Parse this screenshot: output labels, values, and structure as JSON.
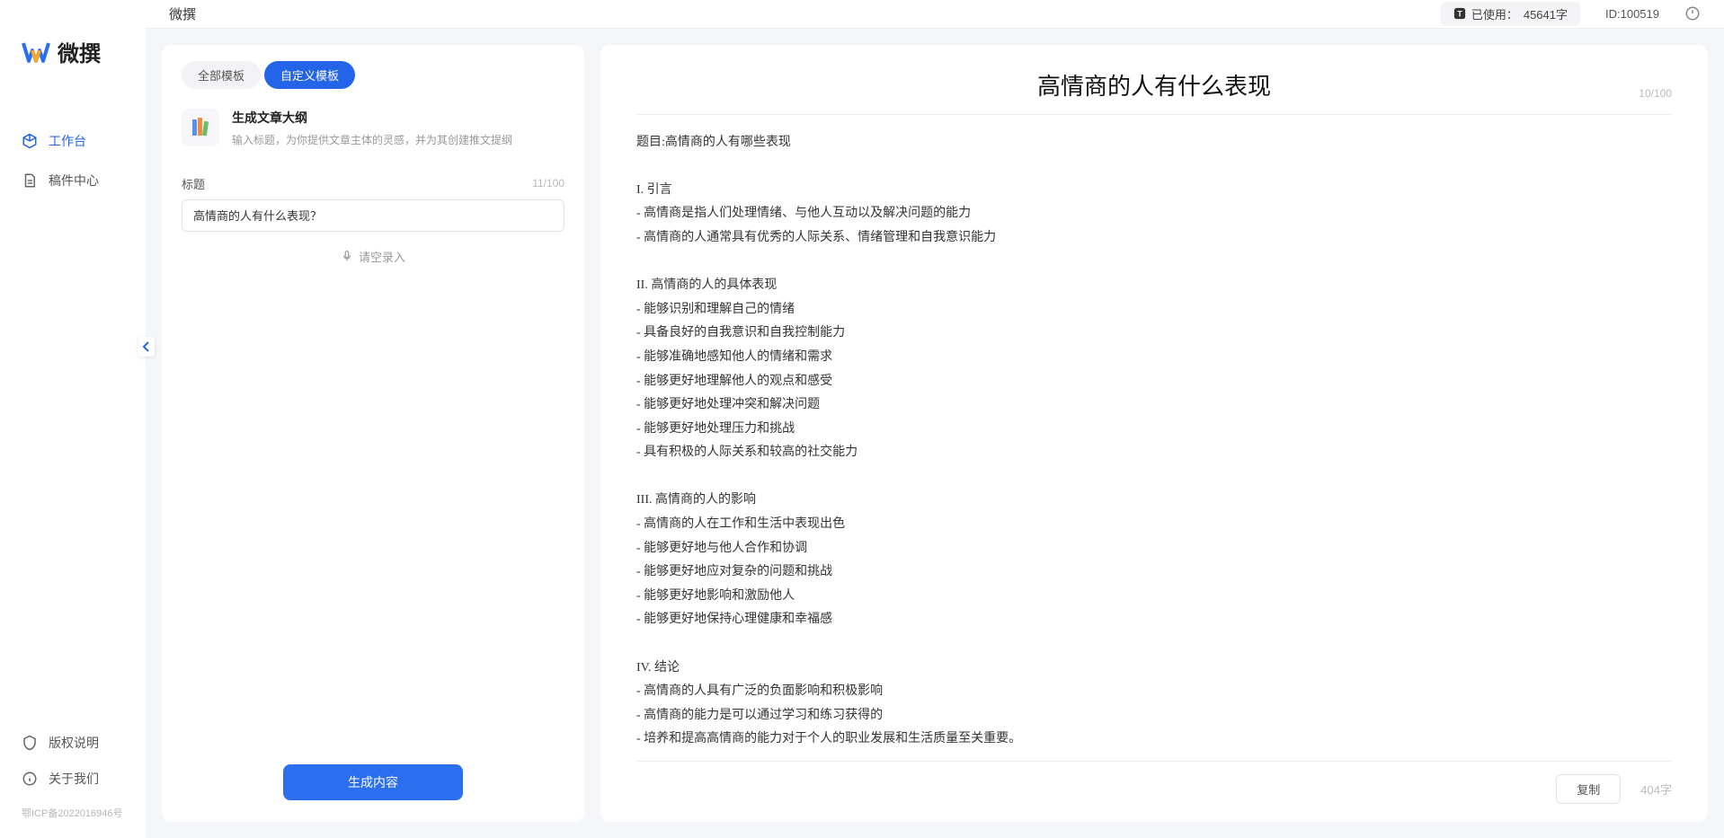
{
  "app": {
    "name": "微撰"
  },
  "header": {
    "title": "微撰",
    "usage_prefix": "已使用：",
    "usage_value": "45641字",
    "user_id": "ID:100519"
  },
  "sidebar": {
    "items": [
      {
        "label": "工作台",
        "active": true
      },
      {
        "label": "稿件中心",
        "active": false
      }
    ],
    "footer": [
      {
        "label": "版权说明"
      },
      {
        "label": "关于我们"
      }
    ],
    "icp": "鄂ICP备2022016946号"
  },
  "left_panel": {
    "tabs": [
      {
        "label": "全部模板",
        "active": false
      },
      {
        "label": "自定义模板",
        "active": true
      }
    ],
    "template": {
      "title": "生成文章大纲",
      "desc": "输入标题，为你提供文章主体的灵感，并为其创建推文提纲"
    },
    "form": {
      "title_label": "标题",
      "title_value": "高情商的人有什么表现？",
      "title_count": "11/100",
      "voice_hint": "请空录入"
    },
    "generate_btn": "生成内容"
  },
  "right_panel": {
    "title": "高情商的人有什么表现",
    "title_count": "10/100",
    "body": "题目:高情商的人有哪些表现\n\nI. 引言\n- 高情商是指人们处理情绪、与他人互动以及解决问题的能力\n- 高情商的人通常具有优秀的人际关系、情绪管理和自我意识能力\n\nII. 高情商的人的具体表现\n- 能够识别和理解自己的情绪\n- 具备良好的自我意识和自我控制能力\n- 能够准确地感知他人的情绪和需求\n- 能够更好地理解他人的观点和感受\n- 能够更好地处理冲突和解决问题\n- 能够更好地处理压力和挑战\n- 具有积极的人际关系和较高的社交能力\n\nIII. 高情商的人的影响\n- 高情商的人在工作和生活中表现出色\n- 能够更好地与他人合作和协调\n- 能够更好地应对复杂的问题和挑战\n- 能够更好地影响和激励他人\n- 能够更好地保持心理健康和幸福感\n\nIV. 结论\n- 高情商的人具有广泛的负面影响和积极影响\n- 高情商的能力是可以通过学习和练习获得的\n- 培养和提高高情商的能力对于个人的职业发展和生活质量至关重要。",
    "copy_btn": "复制",
    "word_count": "404字"
  }
}
